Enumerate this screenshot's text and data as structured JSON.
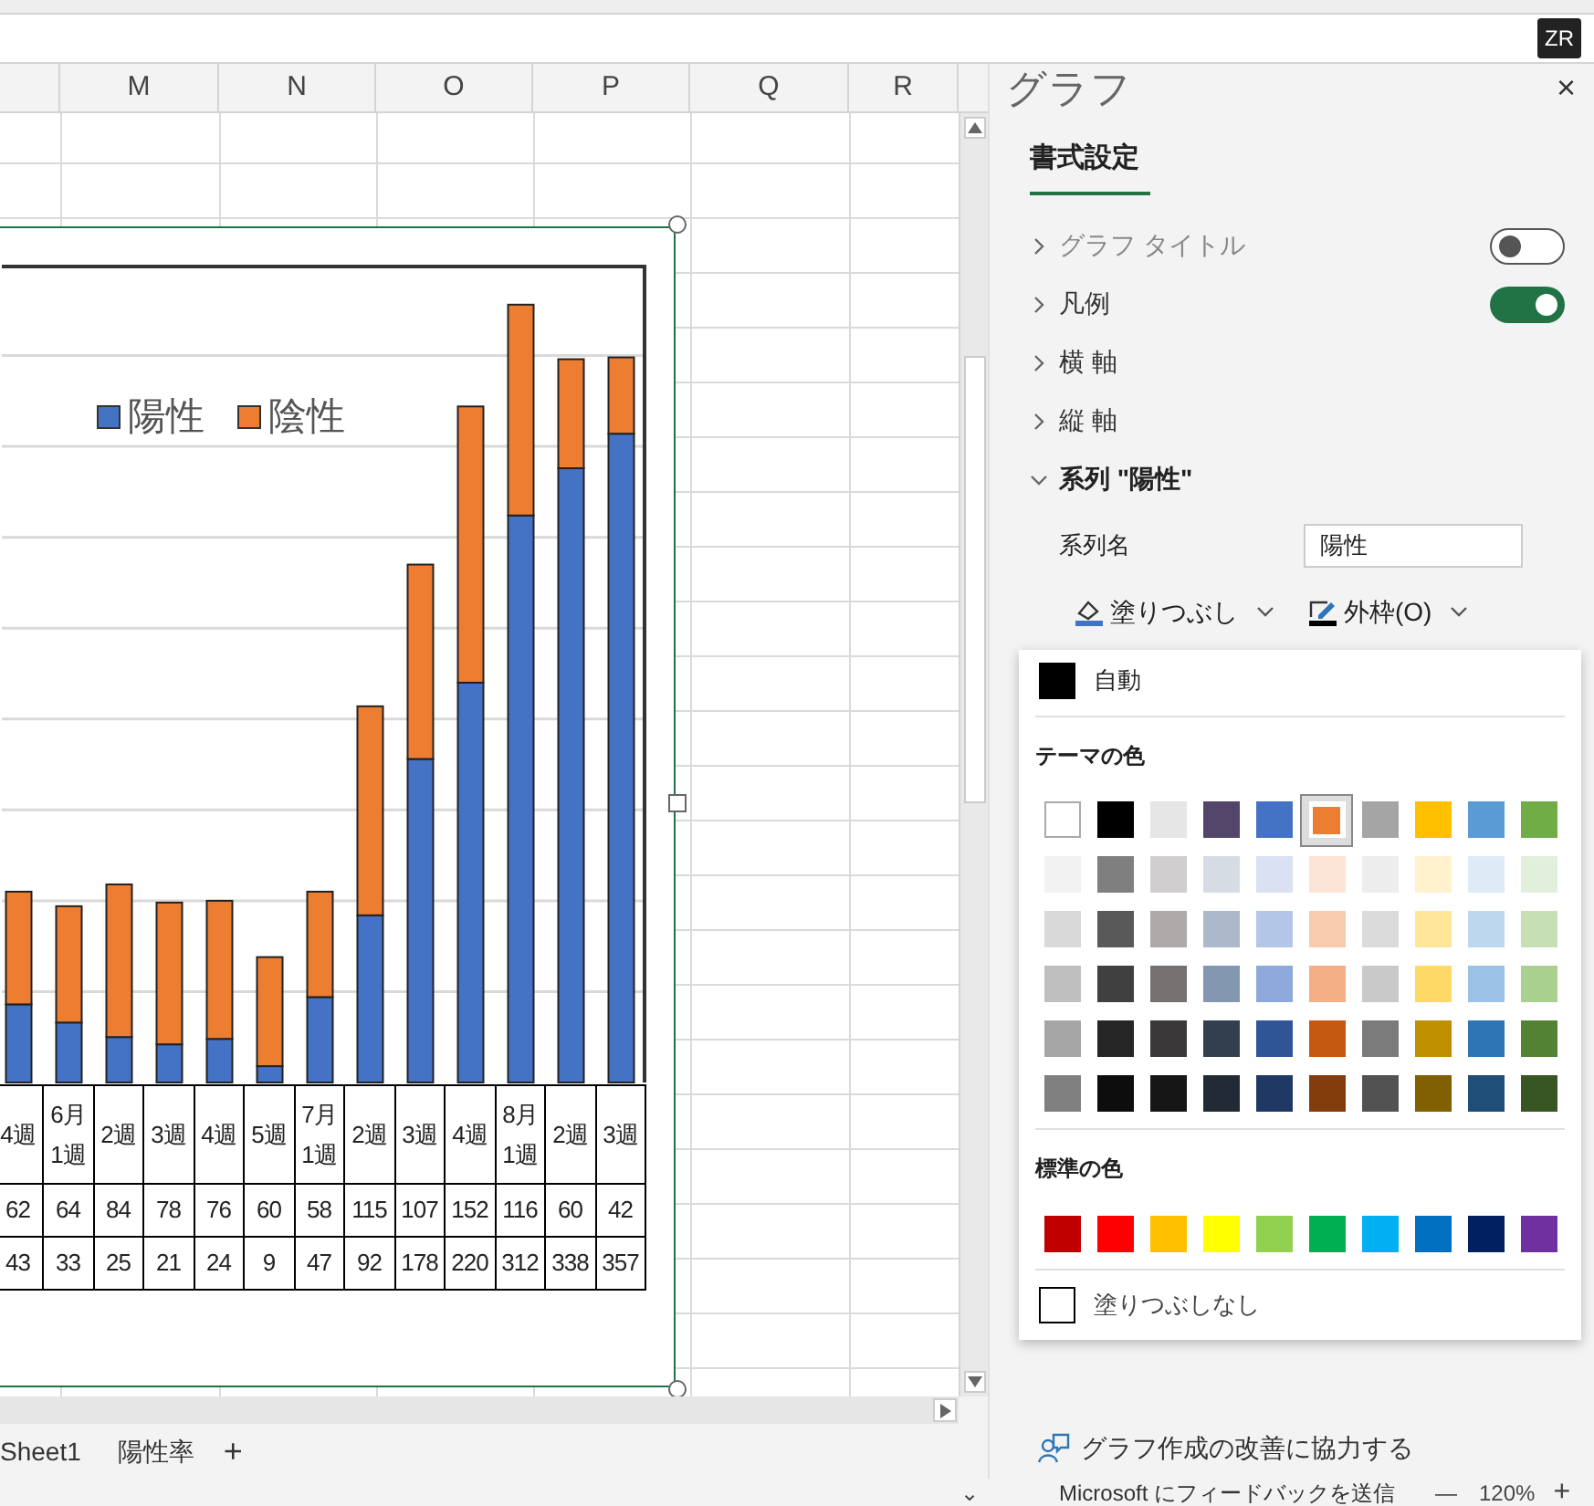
{
  "badge": "ZR",
  "columns": [
    "M",
    "N",
    "O",
    "P",
    "Q",
    "R"
  ],
  "chart": {
    "chart_data": {
      "type": "bar",
      "stacked": true,
      "data_labels": true,
      "categories": [
        "4週",
        "6月1週",
        "2週",
        "3週",
        "4週",
        "5週",
        "7月1週",
        "2週",
        "3週",
        "4週",
        "8月1週",
        "2週",
        "3週"
      ],
      "series": [
        {
          "name": "陽性",
          "color": "#4472c4",
          "values": [
            43,
            33,
            25,
            21,
            24,
            9,
            47,
            92,
            178,
            220,
            312,
            338,
            357
          ]
        },
        {
          "name": "陰性",
          "color": "#ed7d31",
          "values": [
            62,
            64,
            84,
            78,
            76,
            60,
            58,
            115,
            107,
            152,
            116,
            60,
            42
          ]
        }
      ]
    }
  },
  "sheet_tabs": [
    "Sheet1",
    "陽性率",
    "+"
  ],
  "status_bar": {
    "collapse": "⌄",
    "feedback": "Microsoft にフィードバックを送信",
    "zoom_out": "—",
    "zoom": "120%",
    "zoom_in": "+"
  },
  "panel": {
    "title": "グラフ",
    "close": "×",
    "tab": {
      "label": "書式設定",
      "selected": true
    },
    "sections": [
      {
        "kind": "toggle",
        "label": "グラフ タイトル",
        "expanded": false,
        "on": false
      },
      {
        "kind": "toggle",
        "label": "凡例",
        "expanded": false,
        "on": true
      },
      {
        "kind": "plain",
        "label": "横 軸",
        "expanded": false
      },
      {
        "kind": "plain",
        "label": "縦 軸",
        "expanded": false
      },
      {
        "kind": "plain",
        "label": "系列 \"陽性\"",
        "expanded": true
      }
    ],
    "series_name": {
      "label": "系列名",
      "value": "陽性"
    },
    "fill_button": "塗りつぶし",
    "outline_button": "外枠(O)",
    "palette": {
      "automatic": "自動",
      "theme_heading": "テーマの色",
      "theme_colors": [
        [
          {
            "color": "#ffffff",
            "selected": false
          },
          {
            "color": "#000000",
            "selected": false
          },
          {
            "color": "#e7e6e6",
            "selected": false
          },
          {
            "color": "#54456b",
            "selected": false
          },
          {
            "color": "#4472c4",
            "selected": false
          },
          {
            "color": "#ed7d31",
            "selected": true
          },
          {
            "color": "#a5a5a5",
            "selected": false
          },
          {
            "color": "#ffc000",
            "selected": false
          },
          {
            "color": "#5b9bd5",
            "selected": false
          },
          {
            "color": "#70ad47",
            "selected": false
          }
        ],
        [
          {
            "color": "#f2f2f2",
            "selected": false
          },
          {
            "color": "#7f7f7f",
            "selected": false
          },
          {
            "color": "#d0cece",
            "selected": false
          },
          {
            "color": "#d6dce4",
            "selected": false
          },
          {
            "color": "#d9e1f2",
            "selected": false
          },
          {
            "color": "#fce4d6",
            "selected": false
          },
          {
            "color": "#ededed",
            "selected": false
          },
          {
            "color": "#fff2cc",
            "selected": false
          },
          {
            "color": "#ddebf7",
            "selected": false
          },
          {
            "color": "#e2efda",
            "selected": false
          }
        ],
        [
          {
            "color": "#d9d9d9",
            "selected": false
          },
          {
            "color": "#595959",
            "selected": false
          },
          {
            "color": "#aeaaaa",
            "selected": false
          },
          {
            "color": "#acb9ca",
            "selected": false
          },
          {
            "color": "#b4c6e7",
            "selected": false
          },
          {
            "color": "#f8cbad",
            "selected": false
          },
          {
            "color": "#dbdbdb",
            "selected": false
          },
          {
            "color": "#ffe699",
            "selected": false
          },
          {
            "color": "#bdd7ee",
            "selected": false
          },
          {
            "color": "#c6e0b4",
            "selected": false
          }
        ],
        [
          {
            "color": "#bfbfbf",
            "selected": false
          },
          {
            "color": "#404040",
            "selected": false
          },
          {
            "color": "#757171",
            "selected": false
          },
          {
            "color": "#8497b0",
            "selected": false
          },
          {
            "color": "#8ea9db",
            "selected": false
          },
          {
            "color": "#f4b084",
            "selected": false
          },
          {
            "color": "#c9c9c9",
            "selected": false
          },
          {
            "color": "#ffd966",
            "selected": false
          },
          {
            "color": "#9bc2e6",
            "selected": false
          },
          {
            "color": "#a9d08e",
            "selected": false
          }
        ],
        [
          {
            "color": "#a6a6a6",
            "selected": false
          },
          {
            "color": "#262626",
            "selected": false
          },
          {
            "color": "#3a3838",
            "selected": false
          },
          {
            "color": "#333f4f",
            "selected": false
          },
          {
            "color": "#2f5597",
            "selected": false
          },
          {
            "color": "#c65911",
            "selected": false
          },
          {
            "color": "#7b7b7b",
            "selected": false
          },
          {
            "color": "#bf8f00",
            "selected": false
          },
          {
            "color": "#2e75b6",
            "selected": false
          },
          {
            "color": "#548235",
            "selected": false
          }
        ],
        [
          {
            "color": "#808080",
            "selected": false
          },
          {
            "color": "#0d0d0d",
            "selected": false
          },
          {
            "color": "#161616",
            "selected": false
          },
          {
            "color": "#222b35",
            "selected": false
          },
          {
            "color": "#1f3864",
            "selected": false
          },
          {
            "color": "#833c0c",
            "selected": false
          },
          {
            "color": "#525252",
            "selected": false
          },
          {
            "color": "#806000",
            "selected": false
          },
          {
            "color": "#1f4e78",
            "selected": false
          },
          {
            "color": "#375623",
            "selected": false
          }
        ]
      ],
      "standard_heading": "標準の色",
      "standard_colors": [
        {
          "color": "#c00000",
          "selected": false
        },
        {
          "color": "#ff0000",
          "selected": false
        },
        {
          "color": "#ffc000",
          "selected": false
        },
        {
          "color": "#ffff00",
          "selected": false
        },
        {
          "color": "#92d050",
          "selected": false
        },
        {
          "color": "#00b050",
          "selected": false
        },
        {
          "color": "#00b0f0",
          "selected": false
        },
        {
          "color": "#0070c0",
          "selected": false
        },
        {
          "color": "#002060",
          "selected": false
        },
        {
          "color": "#7030a0",
          "selected": false
        }
      ],
      "no_fill": "塗りつぶしなし"
    },
    "help_link": "グラフ作成の改善に協力する"
  }
}
